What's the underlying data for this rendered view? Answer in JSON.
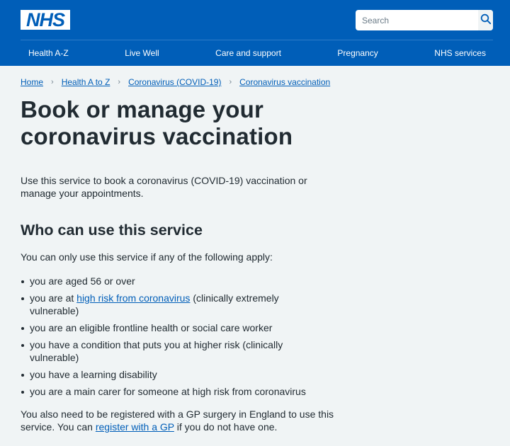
{
  "header": {
    "logo_text": "NHS",
    "search": {
      "placeholder": "Search",
      "button_icon": "search-icon"
    },
    "nav": [
      {
        "label": "Health A-Z"
      },
      {
        "label": "Live Well"
      },
      {
        "label": "Care and support"
      },
      {
        "label": "Pregnancy"
      },
      {
        "label": "NHS services"
      }
    ]
  },
  "breadcrumb": {
    "separator": "›",
    "items": [
      {
        "label": "Home"
      },
      {
        "label": "Health A to Z"
      },
      {
        "label": "Coronavirus (COVID-19)"
      },
      {
        "label": "Coronavirus vaccination"
      }
    ]
  },
  "page": {
    "title": "Book or manage your coronavirus vaccination",
    "lead": "Use this service to book a coronavirus (COVID-19) vaccination or manage your appointments.",
    "section": {
      "heading": "Who can use this service",
      "intro": "You can only use this service if any of the following apply:",
      "criteria": [
        {
          "text": "you are aged 56 or over"
        },
        {
          "prefix": "you are at ",
          "link": "high risk from coronavirus",
          "suffix": " (clinically extremely vulnerable)"
        },
        {
          "text": "you are an eligible frontline health or social care worker"
        },
        {
          "text": "you have a condition that puts you at higher risk (clinically vulnerable)"
        },
        {
          "text": "you have a learning disability"
        },
        {
          "text": "you are a main carer for someone at high risk from coronavirus"
        }
      ],
      "gp_note": {
        "prefix": "You also need to be registered with a GP surgery in England to use this service. You can ",
        "link": "register with a GP",
        "suffix": " if you do not have one."
      }
    }
  },
  "colors": {
    "brand_blue": "#005eb8",
    "page_bg": "#f0f4f5",
    "text": "#212b32"
  }
}
